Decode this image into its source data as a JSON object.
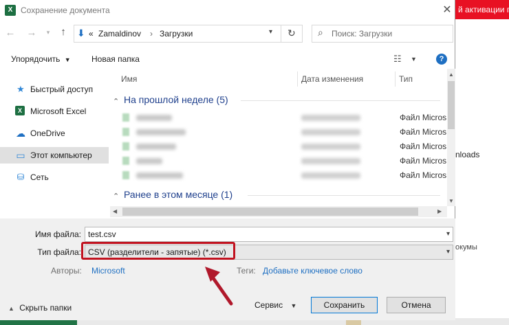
{
  "background": {
    "banner_text": "й активации п",
    "side_text1": "nloads",
    "side_text2": "окумы"
  },
  "dialog": {
    "title": "Сохранение документа",
    "app_icon": "X",
    "close_glyph": "✕"
  },
  "address": {
    "root_glyph": "«",
    "segments": [
      "Zamaldinov",
      "Загрузки"
    ],
    "separator": "›",
    "search_placeholder": "Поиск: Загрузки"
  },
  "toolbar": {
    "organize": "Упорядочить",
    "new_folder": "Новая папка",
    "help": "?"
  },
  "nav": {
    "items": [
      {
        "label": "Быстрый доступ",
        "icon": "star-icon"
      },
      {
        "label": "Microsoft Excel",
        "icon": "excel-icon"
      },
      {
        "label": "OneDrive",
        "icon": "cloud-icon"
      },
      {
        "label": "Этот компьютер",
        "icon": "computer-icon"
      },
      {
        "label": "Сеть",
        "icon": "network-icon"
      }
    ]
  },
  "list": {
    "columns": [
      "Имя",
      "Дата изменения",
      "Тип"
    ],
    "groups": [
      {
        "label": "На прошлой неделе (5)"
      },
      {
        "label": "Ранее в этом месяце (1)"
      }
    ],
    "rows": [
      {
        "type": "Файл Micros"
      },
      {
        "type": "Файл Micros"
      },
      {
        "type": "Файл Micros"
      },
      {
        "type": "Файл Micros"
      },
      {
        "type": "Файл Micros"
      }
    ]
  },
  "form": {
    "filename_label": "Имя файла:",
    "filename_value": "test.csv",
    "filetype_label": "Тип файла:",
    "filetype_value": "CSV (разделители - запятые) (*.csv)",
    "authors_label": "Авторы:",
    "authors_value": "Microsoft",
    "tags_label": "Теги:",
    "tags_value": "Добавьте ключевое слово"
  },
  "footer": {
    "hide_folders": "Скрыть папки",
    "service": "Сервис",
    "save": "Сохранить",
    "cancel": "Отмена"
  },
  "colors": {
    "accent": "#1e6fc2",
    "highlight": "#c1121f",
    "group_header": "#1e3f8c"
  }
}
